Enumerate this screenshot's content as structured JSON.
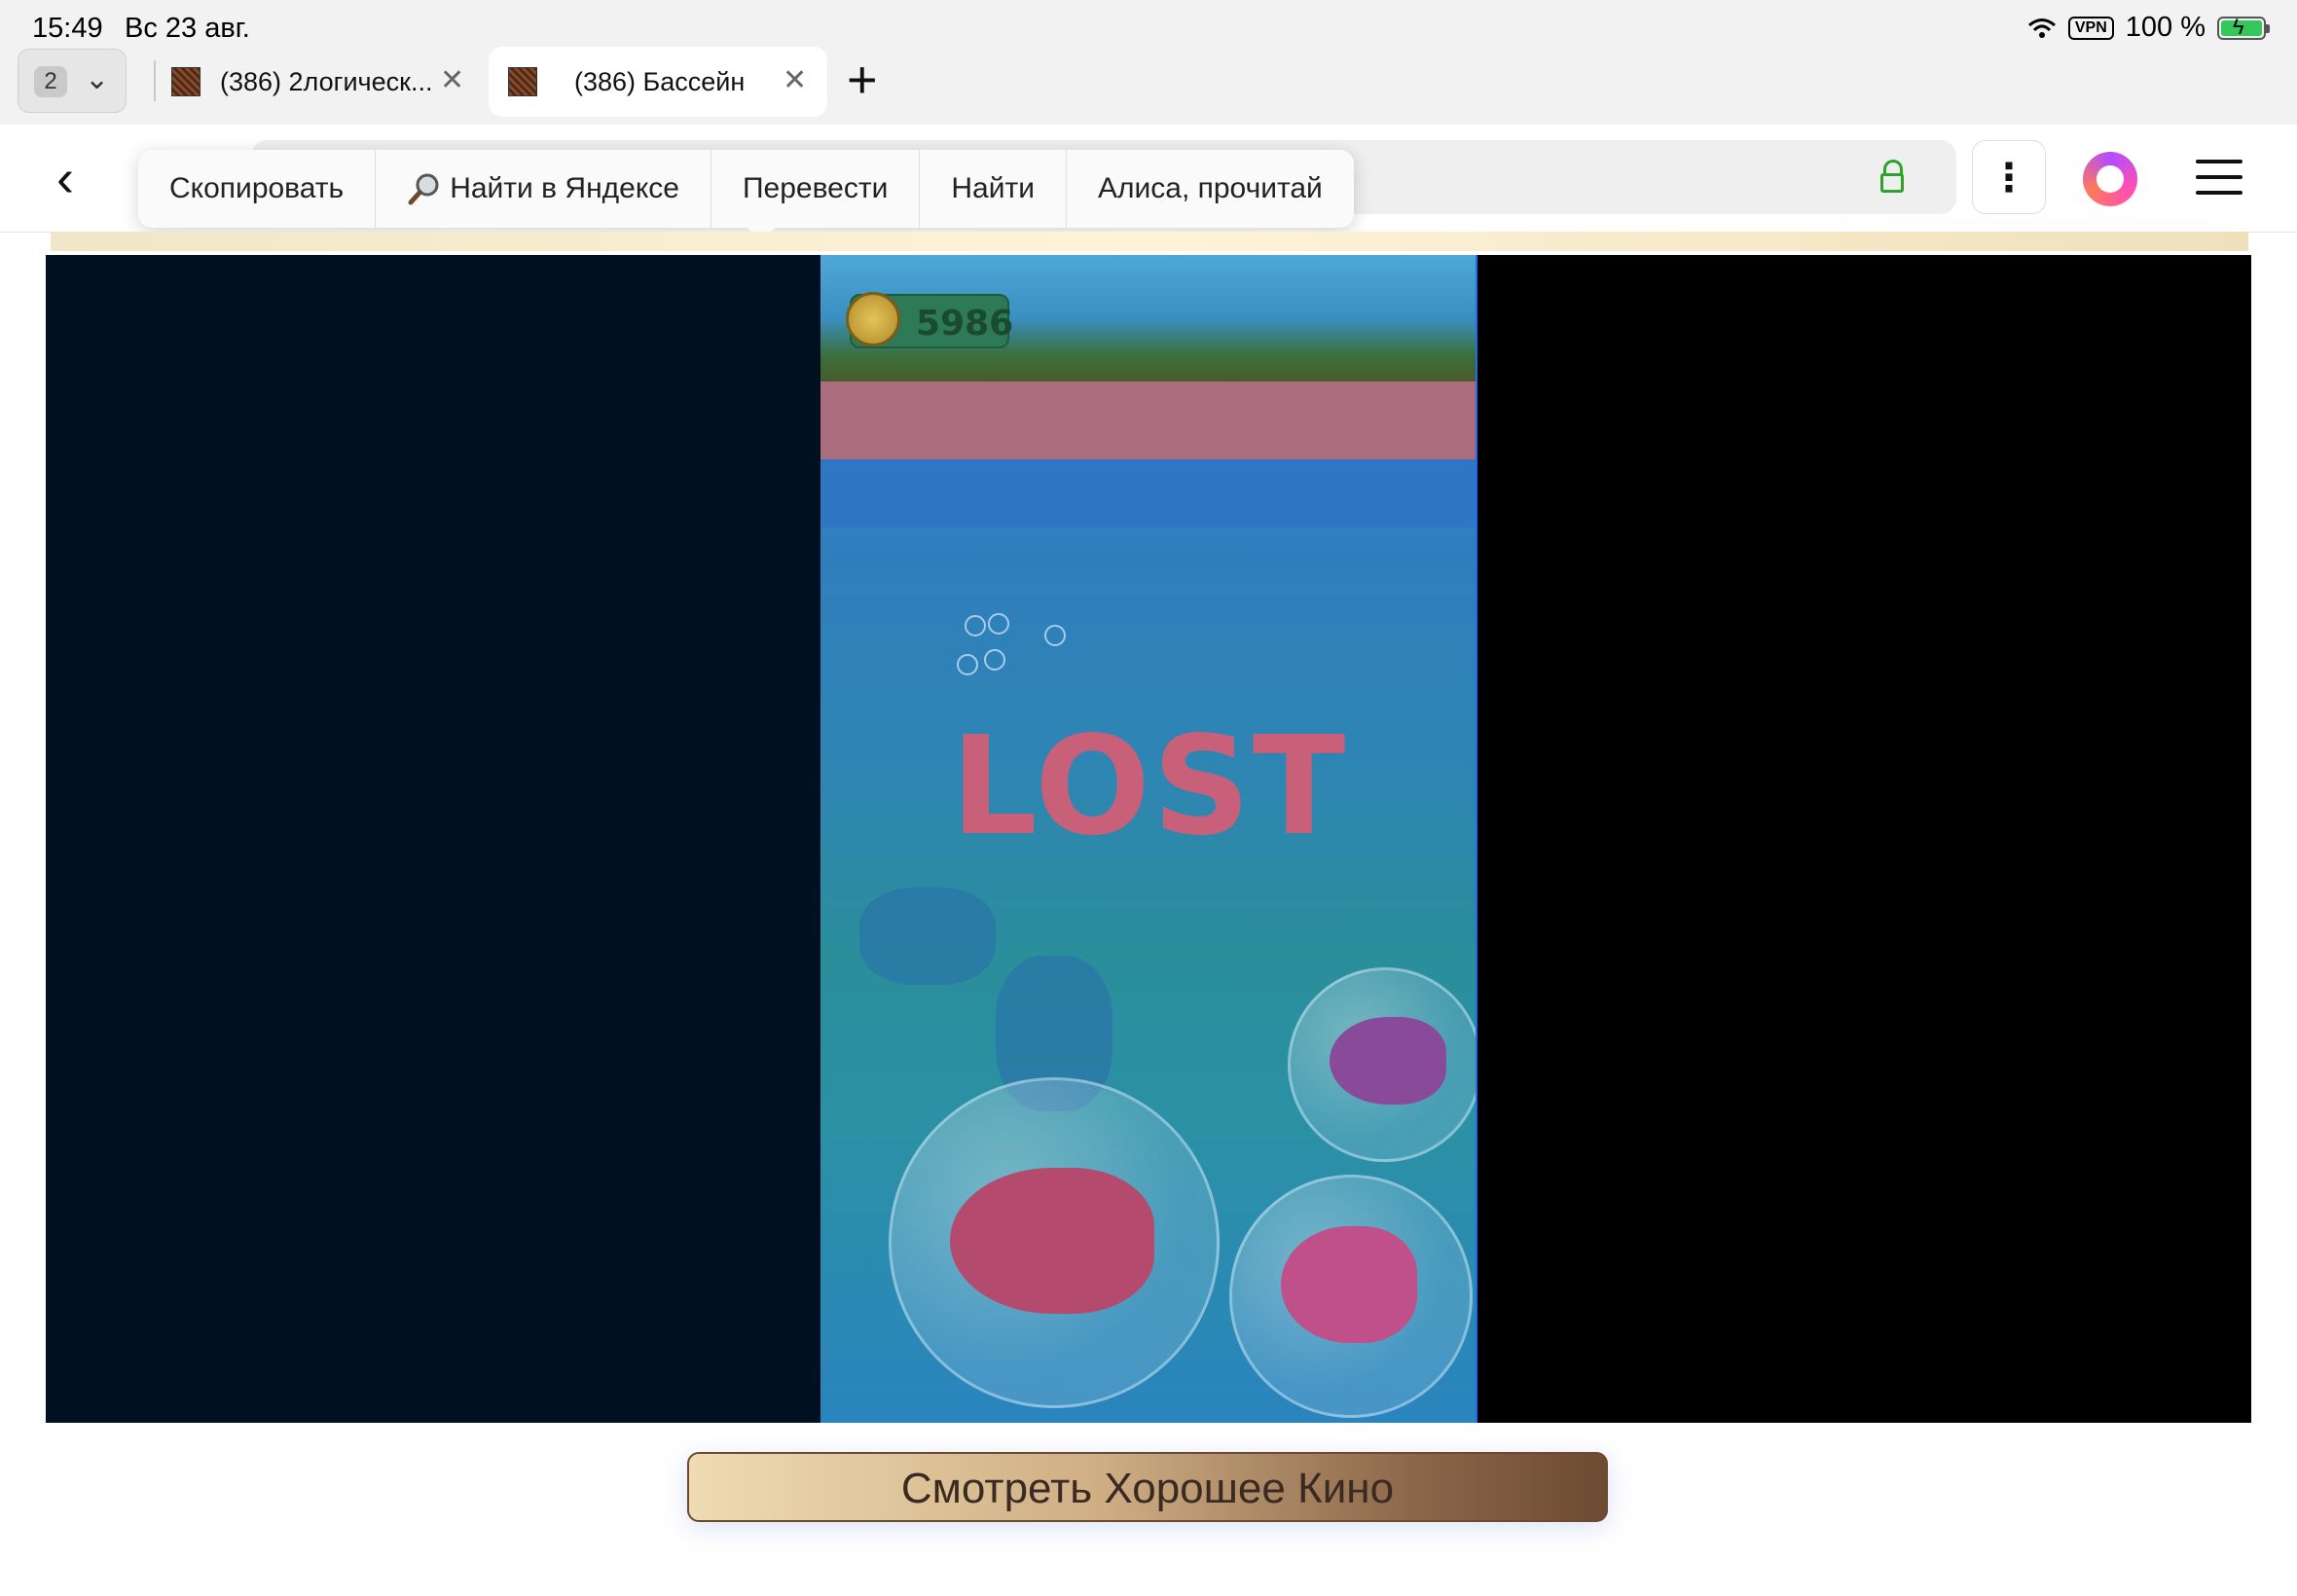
{
  "status_bar": {
    "time": "15:49",
    "date": "Вс 23 авг.",
    "vpn": "VPN",
    "battery": "100 %"
  },
  "tabs": {
    "count": "2",
    "items": [
      {
        "title": "(386) 2логическ..."
      },
      {
        "title": "(386) Бассейн"
      }
    ]
  },
  "context_menu": {
    "items": [
      "Скопировать",
      "Найти в Яндексе",
      "Перевести",
      "Найти",
      "Алиса, прочитай"
    ]
  },
  "game": {
    "score": "5986",
    "status": "LOST"
  },
  "bottom_button": {
    "label": "Смотреть Хорошее Кино"
  },
  "colors": {
    "lock": "#2aa52a",
    "game_border": "#1e6df0",
    "lost_text": "#c8607a"
  },
  "icons": [
    "back-chevron-icon",
    "wifi-icon",
    "battery-icon",
    "close-icon",
    "plus-icon",
    "lock-icon",
    "kebab-icon",
    "alice-icon",
    "hamburger-menu-icon",
    "search-icon",
    "coin-icon"
  ]
}
